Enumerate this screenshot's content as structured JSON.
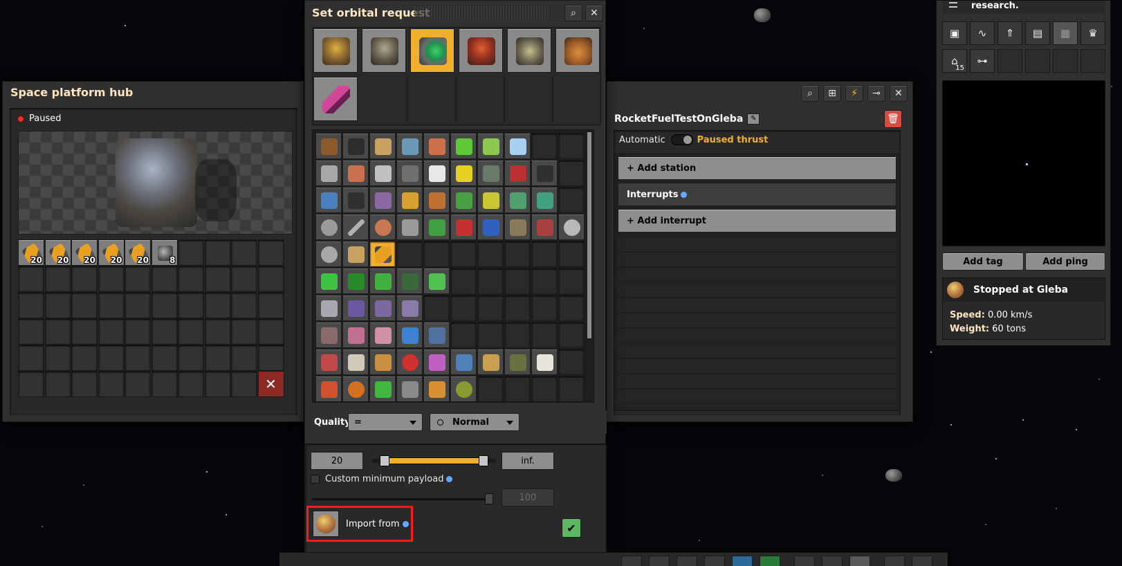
{
  "hub": {
    "title": "Space platform hub",
    "status": "Paused",
    "status_color": "#e03030",
    "inventory": [
      {
        "icon": "rocket-fuel-icon",
        "count": "20"
      },
      {
        "icon": "rocket-fuel-icon",
        "count": "20"
      },
      {
        "icon": "rocket-fuel-icon",
        "count": "20"
      },
      {
        "icon": "rocket-fuel-icon",
        "count": "20"
      },
      {
        "icon": "rocket-fuel-icon",
        "count": "20"
      },
      {
        "icon": "space-platform-foundation-icon",
        "count": "8"
      }
    ],
    "close_label": "✕"
  },
  "request": {
    "title": "Set orbital request",
    "tabs": [
      "logistics-tab-icon",
      "production-tab-icon",
      "intermediate-products-tab-icon",
      "space-tab-icon",
      "combat-tab-icon",
      "other-tab-icon",
      "unsorted-tab-icon"
    ],
    "quality_label": "Quality",
    "quality_comparator": "=",
    "quality_value": "Normal",
    "amount_value": "20",
    "max_value": "inf.",
    "slider_fraction": 0.55,
    "custom_payload_label": "Custom minimum payload",
    "payload_value": "100",
    "import_from_label": "Import from",
    "accent": "#f1b02c"
  },
  "schedule": {
    "name": "RocketFuelTestOnGleba",
    "automatic_label": "Automatic",
    "thrust_label": "Paused thrust",
    "thrust_color": "#f1b02c",
    "add_station_label": "+ Add station",
    "interrupts_label": "Interrupts",
    "add_interrupt_label": "+ Add interrupt"
  },
  "sidebar": {
    "research_text": "research.",
    "add_tag_label": "Add tag",
    "add_ping_label": "Add ping",
    "status_title": "Stopped at Gleba",
    "speed_label": "Speed:",
    "speed_value": "0.00 km/s",
    "weight_label": "Weight:",
    "weight_value": "60 tons",
    "research_count": "15"
  }
}
